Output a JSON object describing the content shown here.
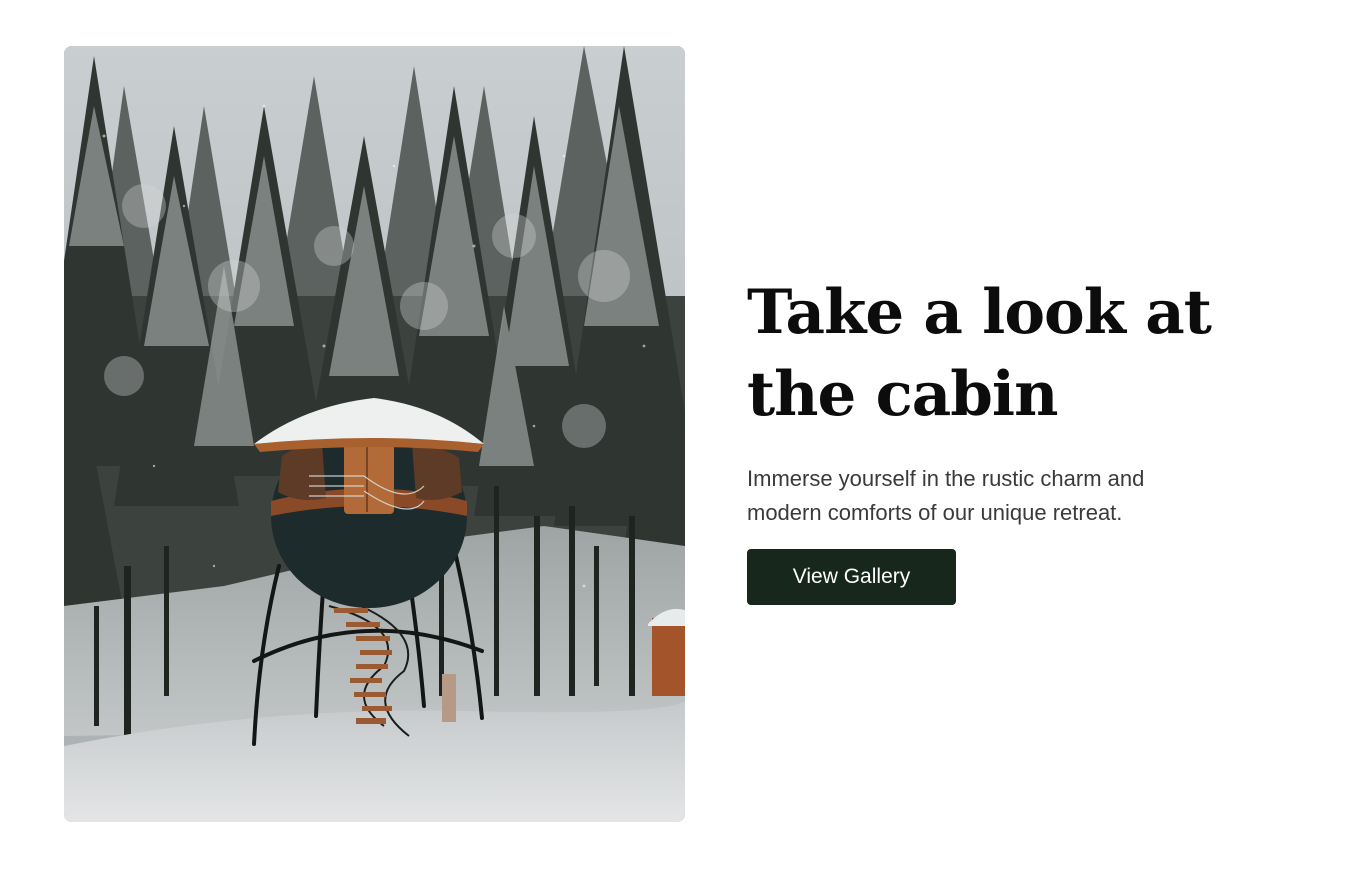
{
  "hero": {
    "image_alt": "Elevated round treehouse cabin with a spiral staircase in a snowy pine forest"
  },
  "content": {
    "headline": "Take a look at the cabin",
    "subtext": "Immerse yourself in the rustic charm and modern comforts of our unique retreat.",
    "cta_label": "View Gallery"
  },
  "colors": {
    "button_background": "#17271c",
    "button_text": "#ffffff",
    "headline": "#0c0c0c",
    "body_text": "#3a3a3a"
  }
}
